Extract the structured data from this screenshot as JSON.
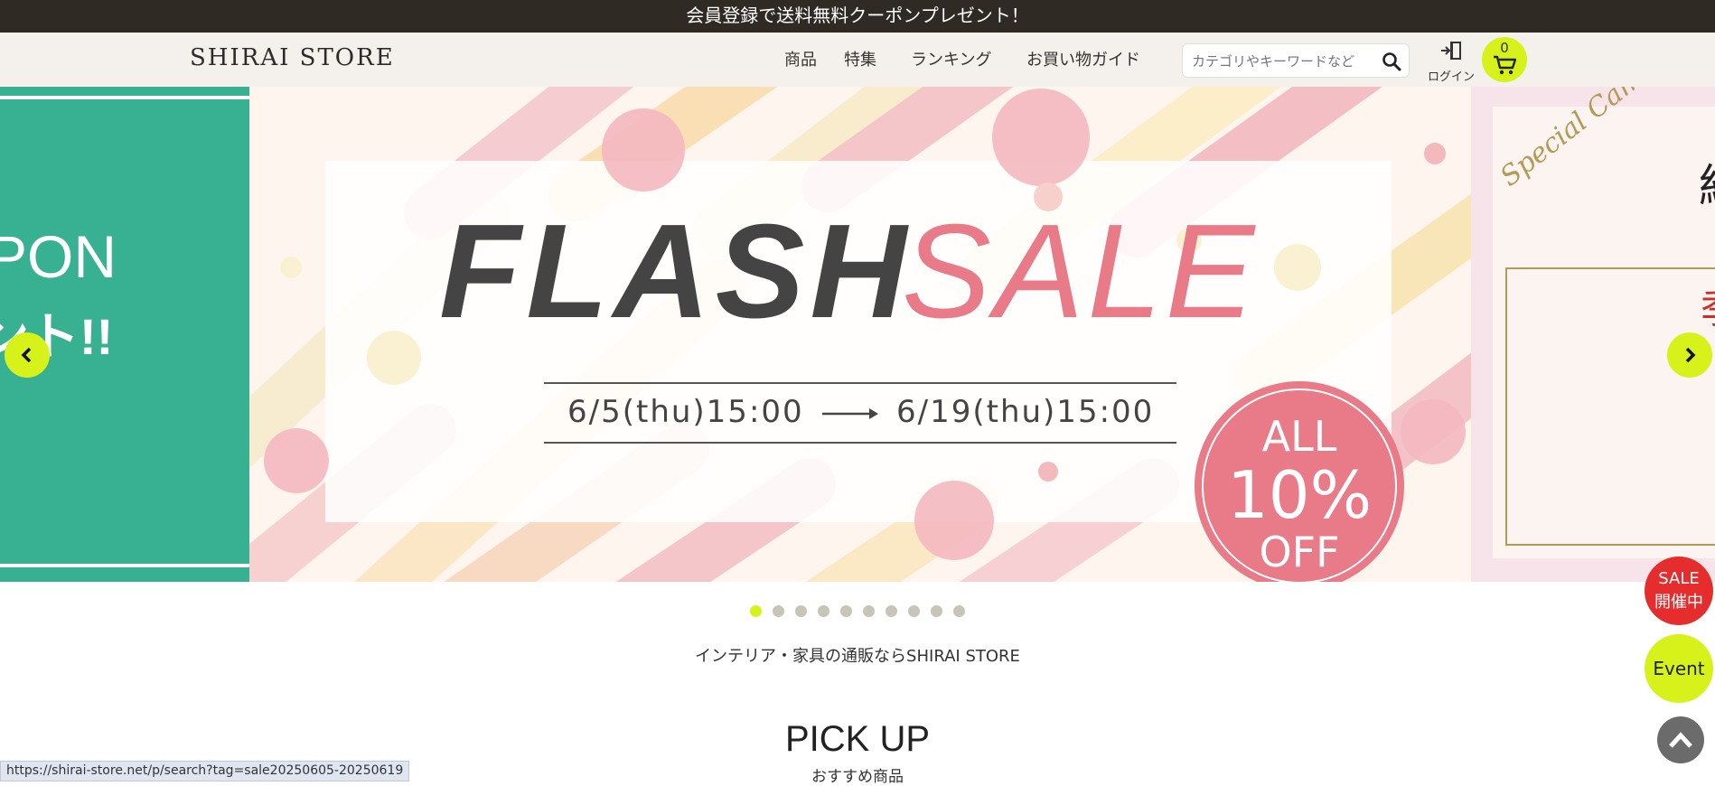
{
  "announcement": "会員登録で送料無料クーポンプレゼント！",
  "header": {
    "logo": "SHIRAI STORE",
    "nav": [
      "商品",
      "特集",
      "ランキング",
      "お買い物ガイド"
    ],
    "search": {
      "placeholder": "カテゴリやキーワードなど",
      "icon": "search-icon"
    },
    "login_label": "ログイン",
    "cart_count": "0"
  },
  "carousel": {
    "prev_slide": {
      "line1": "PON",
      "line2": "ント!!"
    },
    "main_slide": {
      "title_word1": "FLASH",
      "title_word2": "SALE",
      "date_start": "6/5(thu)15:00",
      "date_end": "6/19(thu)15:00",
      "badge_line1": "ALL",
      "badge_line2": "10%",
      "badge_line3": "OFF"
    },
    "next_slide": {
      "script": "Special Campaign",
      "kanji1": "紹",
      "kanji2": "季"
    },
    "dots_total": 10,
    "active_dot": 0
  },
  "tagline": "インテリア・家具の通販ならSHIRAI STORE",
  "pickup": {
    "title": "PICK UP",
    "subtitle": "おすすめ商品"
  },
  "floating": {
    "sale_line1": "SALE",
    "sale_line2": "開催中",
    "event": "Event"
  },
  "status_url": "https://shirai-store.net/p/search?tag=sale20250605-20250619",
  "colors": {
    "accent": "#d6f21a",
    "topbar": "#2f2a24",
    "sale": "#e52d2d",
    "teal": "#38b092",
    "pink": "#e97a88"
  }
}
